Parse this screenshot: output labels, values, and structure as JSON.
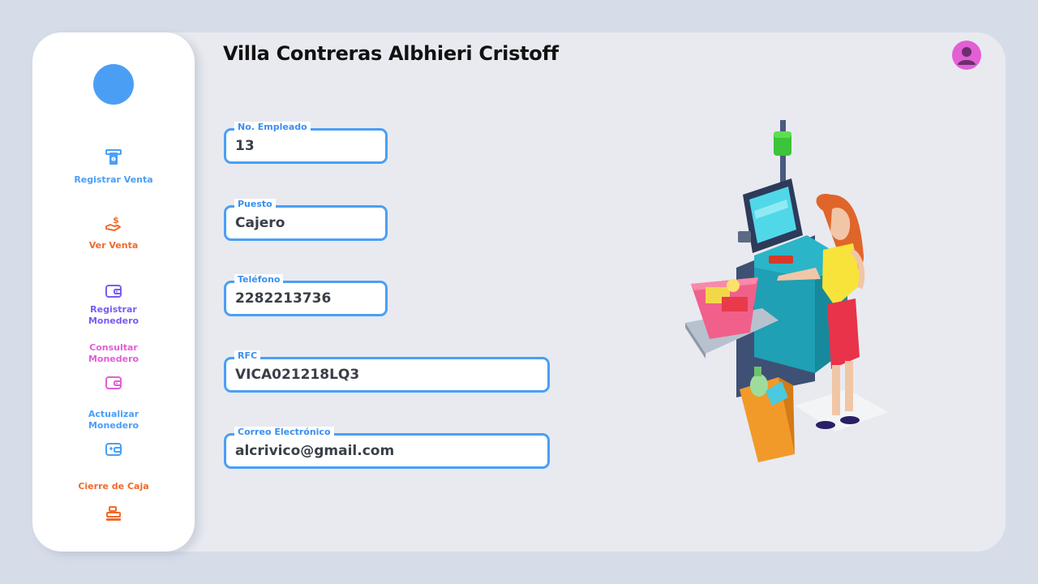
{
  "header": {
    "title": "Villa Contreras Albhieri Cristoff"
  },
  "sidebar": {
    "items": [
      {
        "label": "Registrar Venta",
        "icon": "cash-register-icon",
        "color": "#4a9ff5"
      },
      {
        "label": "Ver Venta",
        "icon": "hand-money-icon",
        "color": "#f06a2a"
      },
      {
        "label": "Registrar Monedero",
        "icon": "wallet-icon",
        "color": "#7a5cf0"
      },
      {
        "label": "Consultar Monedero",
        "icon": "wallet-icon",
        "color": "#e25fd6"
      },
      {
        "label": "Actualizar Monedero",
        "icon": "wallet-card-icon",
        "color": "#4a9ff5"
      },
      {
        "label": "Cierre de Caja",
        "icon": "register-icon",
        "color": "#f06a2a"
      }
    ]
  },
  "form": {
    "employee_number": {
      "label": "No. Empleado",
      "value": "13"
    },
    "position": {
      "label": "Puesto",
      "value": "Cajero"
    },
    "phone": {
      "label": "Teléfono",
      "value": "2282213736"
    },
    "rfc": {
      "label": "RFC",
      "value": "VICA021218LQ3"
    },
    "email": {
      "label": "Correo Electrónico",
      "value": "alcrivico@gmail.com"
    }
  },
  "colors": {
    "accent": "#4a9ff5",
    "orange": "#f06a2a",
    "purple": "#7a5cf0",
    "pink": "#e25fd6",
    "background": "#d6dde9",
    "panel": "#e8eaf0"
  }
}
